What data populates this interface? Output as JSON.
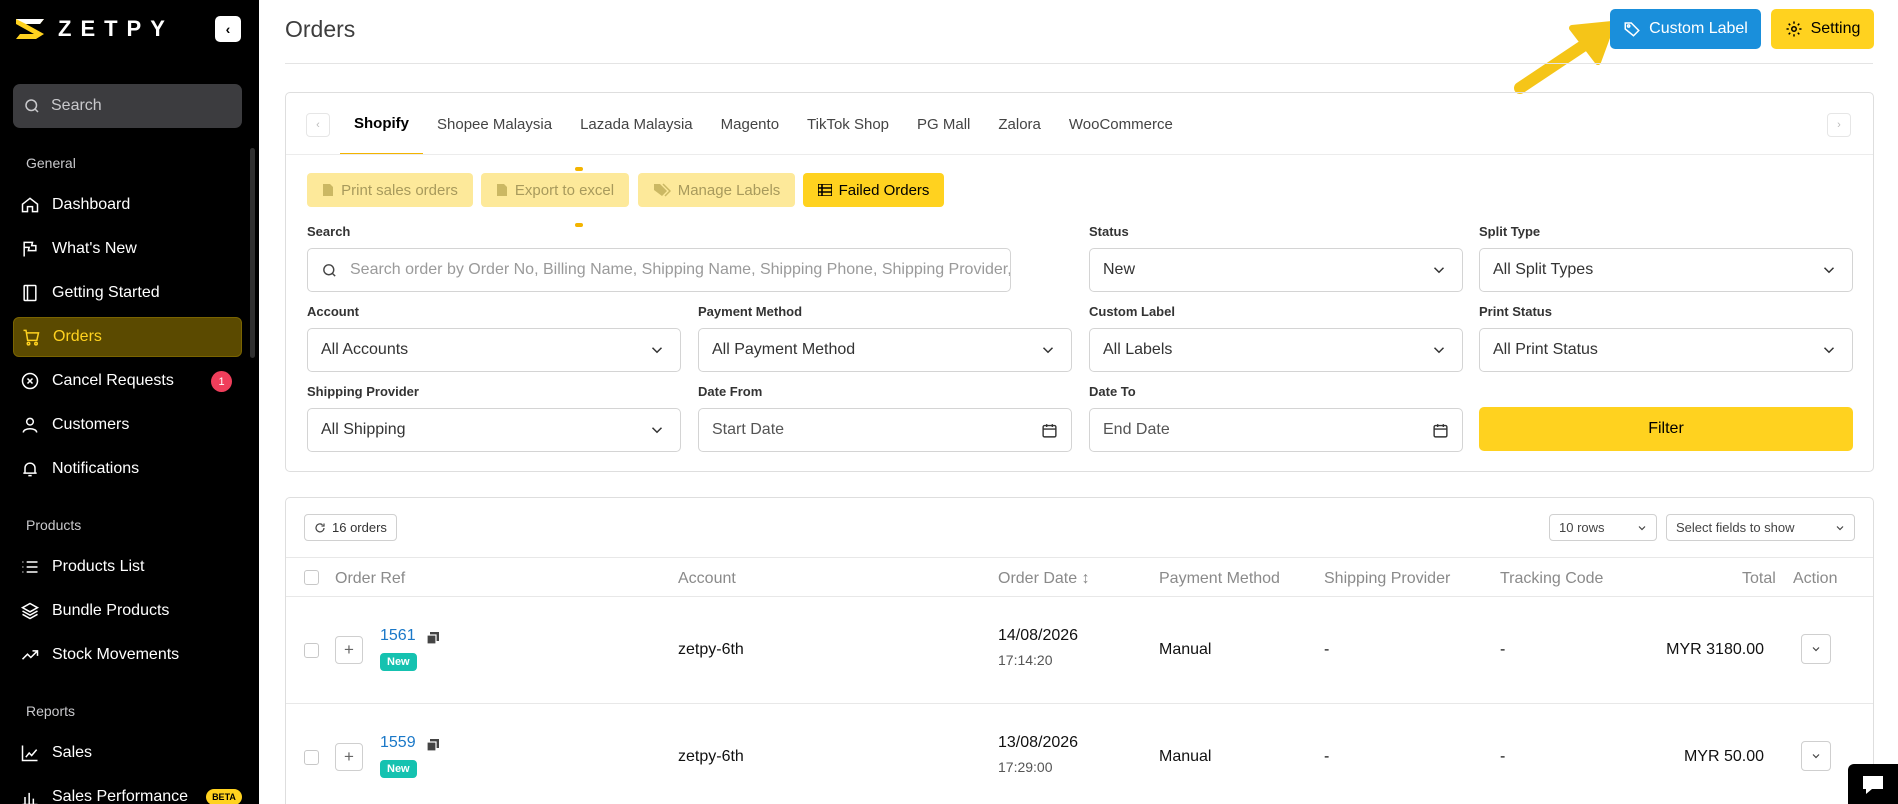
{
  "brand": {
    "name": "ZETPY"
  },
  "sidebar": {
    "search_placeholder": "Search",
    "sections": {
      "general": "General",
      "products": "Products",
      "reports": "Reports"
    },
    "items": {
      "dashboard": "Dashboard",
      "whats_new": "What's New",
      "getting_started": "Getting Started",
      "orders": "Orders",
      "cancel_requests": "Cancel Requests",
      "cancel_requests_count": "1",
      "customers": "Customers",
      "notifications": "Notifications",
      "products_list": "Products List",
      "bundle_products": "Bundle Products",
      "stock_movements": "Stock Movements",
      "sales": "Sales",
      "sales_performance": "Sales Performance",
      "sales_performance_badge": "BETA"
    }
  },
  "header": {
    "title": "Orders",
    "custom_label_button": "Custom Label",
    "setting_button": "Setting"
  },
  "tabs": [
    "Shopify",
    "Shopee Malaysia",
    "Lazada Malaysia",
    "Magento",
    "TikTok Shop",
    "PG Mall",
    "Zalora",
    "WooCommerce"
  ],
  "actions": {
    "print_sales_orders": "Print sales orders",
    "export_to_excel": "Export to excel",
    "manage_labels": "Manage Labels",
    "failed_orders": "Failed Orders"
  },
  "filters": {
    "search_label": "Search",
    "search_placeholder": "Search order by Order No, Billing Name, Shipping Name, Shipping Phone, Shipping Provider, Tracking Code",
    "status_label": "Status",
    "status_value": "New",
    "split_type_label": "Split Type",
    "split_type_value": "All Split Types",
    "account_label": "Account",
    "account_value": "All Accounts",
    "payment_method_label": "Payment Method",
    "payment_method_value": "All Payment Method",
    "custom_label_label": "Custom Label",
    "custom_label_value": "All Labels",
    "print_status_label": "Print Status",
    "print_status_value": "All Print Status",
    "shipping_provider_label": "Shipping Provider",
    "shipping_provider_value": "All Shipping",
    "date_from_label": "Date From",
    "date_from_placeholder": "Start Date",
    "date_to_label": "Date To",
    "date_to_placeholder": "End Date",
    "filter_button": "Filter"
  },
  "table": {
    "orders_count": "16 orders",
    "rows_select": "10 rows",
    "fields_select": "Select fields to show",
    "columns": {
      "order_ref": "Order Ref",
      "account": "Account",
      "order_date": "Order Date ↕",
      "payment_method": "Payment Method",
      "shipping_provider": "Shipping Provider",
      "tracking_code": "Tracking Code",
      "total": "Total",
      "action": "Action"
    },
    "rows": [
      {
        "ref": "1561",
        "status": "New",
        "account": "zetpy-6th",
        "date": "14/08/2026",
        "time": "17:14:20",
        "payment": "Manual",
        "shipping": "-",
        "tracking": "-",
        "total": "MYR 3180.00"
      },
      {
        "ref": "1559",
        "status": "New",
        "account": "zetpy-6th",
        "date": "13/08/2026",
        "time": "17:29:00",
        "payment": "Manual",
        "shipping": "-",
        "tracking": "-",
        "total": "MYR 50.00"
      }
    ]
  },
  "colors": {
    "accent_yellow": "#ffd21f",
    "primary_blue": "#1a8fdb",
    "status_new": "#15c2b0",
    "badge_red": "#ef3e5b",
    "arrow": "#f5c518"
  },
  "icons": [
    "search-icon",
    "home-icon",
    "flag-icon",
    "book-icon",
    "cart-icon",
    "x-circle-icon",
    "user-icon",
    "bell-icon",
    "list-icon",
    "layers-icon",
    "trending-icon",
    "chart-icon",
    "tag-icon",
    "gear-icon",
    "chevron-down-icon",
    "calendar-icon",
    "refresh-icon",
    "copy-icon",
    "chat-icon"
  ]
}
